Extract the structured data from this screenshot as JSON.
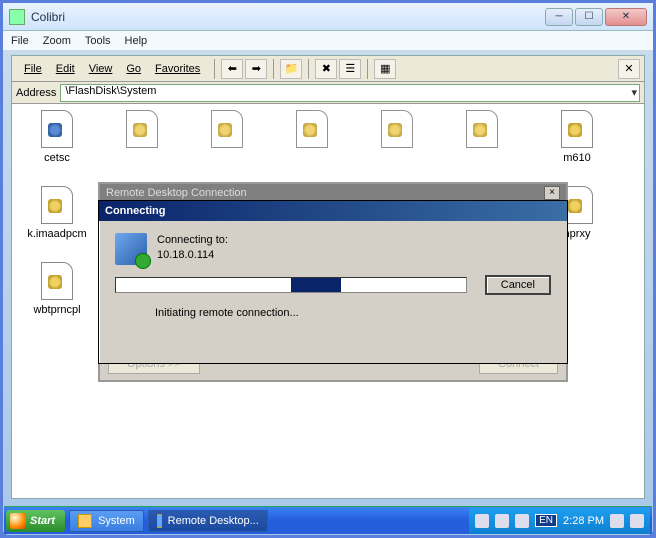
{
  "outer_window": {
    "title": "Colibri",
    "menu": [
      "File",
      "Zoom",
      "Tools",
      "Help"
    ]
  },
  "explorer": {
    "menu": [
      "File",
      "Edit",
      "View",
      "Go",
      "Favorites"
    ],
    "address_label": "Address",
    "address_value": "\\FlashDisk\\System",
    "icons": [
      {
        "label": "cetsc",
        "kind": "exe"
      },
      {
        "label": "k.imaadpcm",
        "kind": "dll"
      },
      {
        "label": "wbtprncpl",
        "kind": "dll"
      },
      {
        "label": "m610",
        "kind": "dll"
      },
      {
        "label": "nprxy",
        "kind": "dll"
      }
    ]
  },
  "rdc_back": {
    "title": "Remote Desktop Connection",
    "options_label": "Options >>",
    "connect_label": "Connect"
  },
  "connecting": {
    "title": "Connecting",
    "connecting_to_label": "Connecting to:",
    "host": "10.18.0.114",
    "cancel_label": "Cancel",
    "status": "Initiating remote connection..."
  },
  "taskbar": {
    "start": "Start",
    "items": [
      {
        "label": "System"
      },
      {
        "label": "Remote Desktop..."
      }
    ],
    "lang": "EN",
    "clock": "2:28 PM"
  }
}
